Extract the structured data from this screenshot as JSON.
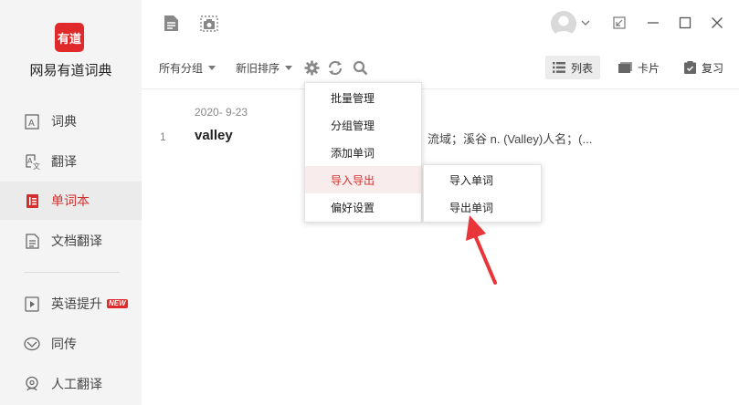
{
  "app": {
    "logo_text": "有道",
    "name": "网易有道词典"
  },
  "sidebar": {
    "items": [
      {
        "label": "词典",
        "icon": "dictionary-icon"
      },
      {
        "label": "翻译",
        "icon": "translate-icon"
      },
      {
        "label": "单词本",
        "icon": "wordbook-icon",
        "active": true
      },
      {
        "label": "文档翻译",
        "icon": "document-icon"
      },
      {
        "label": "英语提升",
        "icon": "video-icon",
        "badge": "NEW"
      },
      {
        "label": "同传",
        "icon": "simultaneous-icon"
      },
      {
        "label": "人工翻译",
        "icon": "human-translation-icon"
      }
    ]
  },
  "toolbar": {
    "group_select": "所有分组",
    "sort_select": "新旧排序",
    "views": {
      "list": "列表",
      "card": "卡片",
      "review": "复习"
    }
  },
  "word_list": {
    "date": "2020- 9-23",
    "entries": [
      {
        "index": "1",
        "word": "valley",
        "definition": "；流域；溪谷  n. (Valley)人名；(..."
      }
    ]
  },
  "settings_menu": {
    "items": [
      "批量管理",
      "分组管理",
      "添加单词",
      "导入导出",
      "偏好设置"
    ]
  },
  "import_export_submenu": {
    "items": [
      "导入单词",
      "导出单词"
    ]
  },
  "colors": {
    "accent": "#e0292b",
    "arrow": "#e8353a"
  }
}
